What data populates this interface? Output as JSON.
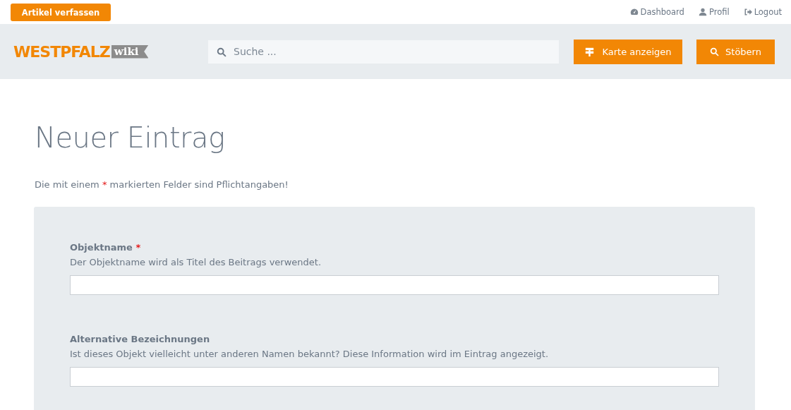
{
  "topbar": {
    "write_button": "Artikel verfassen",
    "links": [
      {
        "kind": "dashboard",
        "label": "Dashboard"
      },
      {
        "kind": "profile",
        "label": "Profil"
      },
      {
        "kind": "logout",
        "label": "Logout"
      }
    ]
  },
  "header": {
    "logo": {
      "brand": "WESTPFALZ",
      "tag": "wiki"
    },
    "search": {
      "placeholder": "Suche ..."
    },
    "buttons": [
      {
        "kind": "map",
        "label": "Karte anzeigen"
      },
      {
        "kind": "search",
        "label": "Stöbern"
      }
    ]
  },
  "page": {
    "title": "Neuer Eintrag",
    "intro": {
      "before": "Die mit einem ",
      "mark": "*",
      "after": " markierten Felder sind Pflichtangaben!"
    },
    "fields": [
      {
        "label": "Objektname",
        "required_mark": "*",
        "hint": "Der Objektname wird als Titel des Beitrags verwendet."
      },
      {
        "label": "Alternative Bezeichnungen",
        "hint": "Ist dieses Objekt vielleicht unter anderen Namen bekannt? Diese Information wird im Eintrag angezeigt."
      }
    ]
  }
}
